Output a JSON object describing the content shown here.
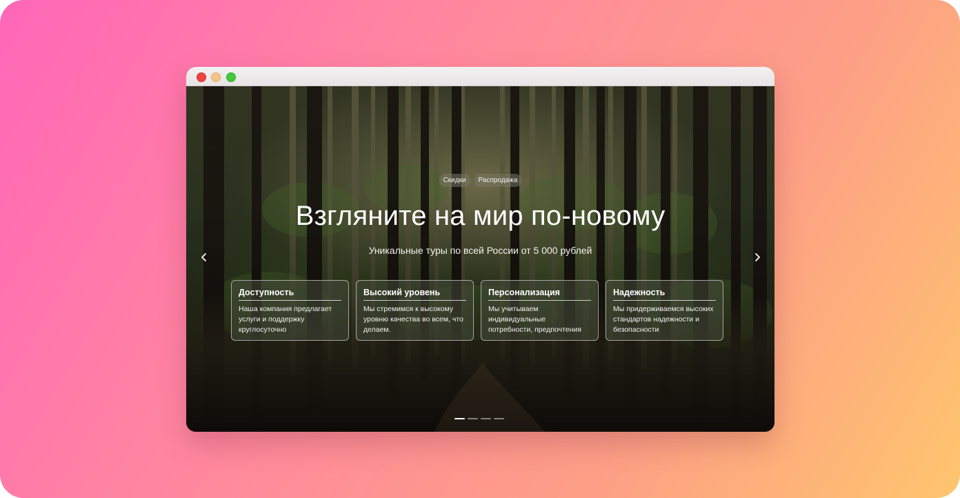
{
  "hero": {
    "tags": [
      "Скидки",
      "Распродажа"
    ],
    "headline": "Взгляните на мир по-новому",
    "subline": "Уникальные туры по всей России от 5 000 рублей",
    "prev_icon": "chevron-left-icon",
    "next_icon": "chevron-right-icon"
  },
  "features": [
    {
      "title": "Доступность",
      "text": "Наша компания предлагает услуги и поддержку круглосуточно"
    },
    {
      "title": "Высокий уровень",
      "text": "Мы стремимся к высокому уровню качества во всем, что делаем."
    },
    {
      "title": "Персонализация",
      "text": "Мы учитываем индивидуальные потребности, предпочтения"
    },
    {
      "title": "Надежность",
      "text": "Мы придерживаемся высоких стандартов надежности и безопасности"
    }
  ],
  "carousel": {
    "slides": 4,
    "active_index": 0
  },
  "colors": {
    "backdrop_start": "#ff66b8",
    "backdrop_end": "#fec56e",
    "close": "#ee4541",
    "minimize": "#f6c388",
    "maximize": "#46c83a"
  }
}
